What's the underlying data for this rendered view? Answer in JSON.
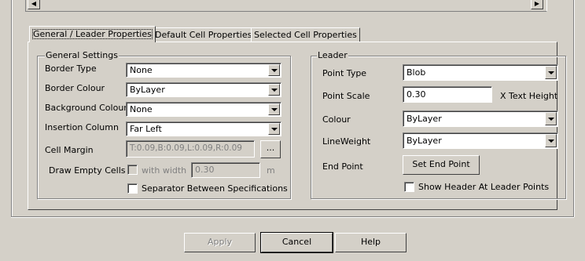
{
  "scroll": {
    "left_arrow": "◀",
    "right_arrow": "▶"
  },
  "tabs": [
    {
      "label": "General / Leader Properties",
      "active": true
    },
    {
      "label": "Default Cell Properties",
      "active": false
    },
    {
      "label": "Selected Cell Properties",
      "active": false
    }
  ],
  "general": {
    "title": "General Settings",
    "border_type": {
      "label": "Border Type",
      "value": "None"
    },
    "border_colour": {
      "label": "Border Colour",
      "value": "ByLayer"
    },
    "background_colour": {
      "label": "Background Colour",
      "value": "None"
    },
    "insertion_column": {
      "label": "Insertion Column",
      "value": "Far Left"
    },
    "cell_margin": {
      "label": "Cell Margin",
      "value": "T:0.09,B:0.09,L:0.09,R:0.09",
      "button": "..."
    },
    "draw_empty_cells": {
      "label": "Draw Empty Cells",
      "with_width": "with width",
      "width_value": "0.30",
      "unit": "m"
    },
    "separator": {
      "label": "Separator Between Specifications"
    }
  },
  "leader": {
    "title": "Leader",
    "point_type": {
      "label": "Point Type",
      "value": "Blob"
    },
    "point_scale": {
      "label": "Point Scale",
      "value": "0.30",
      "suffix": "X Text Height"
    },
    "colour": {
      "label": "Colour",
      "value": "ByLayer"
    },
    "lineweight": {
      "label": "LineWeight",
      "value": "ByLayer"
    },
    "end_point": {
      "label": "End Point",
      "button": "Set End Point"
    },
    "show_header": {
      "label": "Show Header At Leader Points"
    }
  },
  "footer": {
    "apply": "Apply",
    "cancel": "Cancel",
    "help": "Help"
  }
}
